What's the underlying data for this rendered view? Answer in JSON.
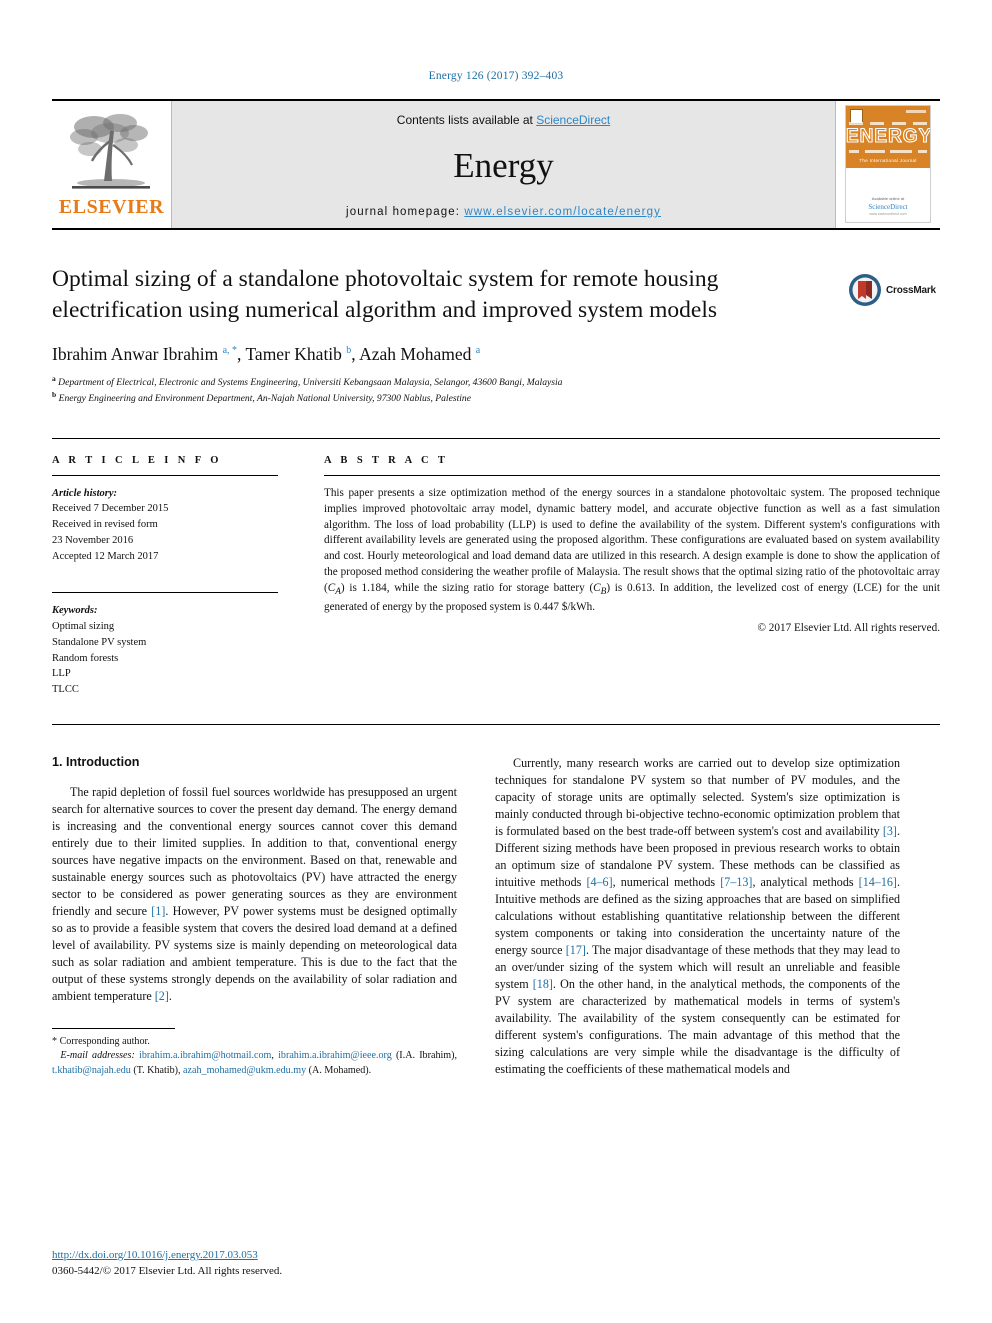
{
  "running_head": "Energy 126 (2017) 392–403",
  "banner": {
    "publisher_logo_label": "ELSEVIER",
    "contents_prefix": "Contents lists available at ",
    "contents_link": "ScienceDirect",
    "journal_name": "Energy",
    "homepage_prefix": "journal homepage: ",
    "homepage_url": "www.elsevier.com/locate/energy",
    "cover": {
      "title": "ENERGY",
      "tagline": "The International Journal",
      "available_at": "Available online at",
      "sciencedirect": "ScienceDirect",
      "sd_sub": "www.sciencedirect.com"
    }
  },
  "article": {
    "title": "Optimal sizing of a standalone photovoltaic system for remote housing electrification using numerical algorithm and improved system models",
    "crossmark_label": "CrossMark",
    "authors_html": "Ibrahim Anwar Ibrahim <sup>a, *</sup>, Tamer Khatib <sup>b</sup>, Azah Mohamed <sup>a</sup>",
    "affiliations": [
      "Department of Electrical, Electronic and Systems Engineering, Universiti Kebangsaan Malaysia, Selangor, 43600 Bangi, Malaysia",
      "Energy Engineering and Environment Department, An-Najah National University, 97300 Nablus, Palestine"
    ],
    "affiliation_marks": [
      "a",
      "b"
    ]
  },
  "article_info": {
    "heading": "A R T I C L E   I N F O",
    "history_label": "Article history:",
    "history": [
      "Received 7 December 2015",
      "Received in revised form",
      "23 November 2016",
      "Accepted 12 March 2017"
    ],
    "keywords_label": "Keywords:",
    "keywords": [
      "Optimal sizing",
      "Standalone PV system",
      "Random forests",
      "LLP",
      "TLCC"
    ]
  },
  "abstract": {
    "heading": "A B S T R A C T",
    "text_html": "This paper presents a size optimization method of the energy sources in a standalone photovoltaic system. The proposed technique implies improved photovoltaic array model, dynamic battery model, and accurate objective function as well as a fast simulation algorithm. The loss of load probability (LLP) is used to define the availability of the system. Different system's configurations with different availability levels are generated using the proposed algorithm. These configurations are evaluated based on system availability and cost. Hourly meteorological and load demand data are utilized in this research. A design example is done to show the application of the proposed method considering the weather profile of Malaysia. The result shows that the optimal sizing ratio of the photovoltaic array (<i>C<sub>A</sub></i>) is 1.184, while the sizing ratio for storage battery (<i>C<sub>B</sub></i>) is 0.613. In addition, the levelized cost of energy (LCE) for the unit generated of energy by the proposed system is 0.447 $/kWh.",
    "copyright": "© 2017 Elsevier Ltd. All rights reserved."
  },
  "body": {
    "section_number_title": "1. Introduction",
    "left_paragraphs_html": [
      "The rapid depletion of fossil fuel sources worldwide has presupposed an urgent search for alternative sources to cover the present day demand. The energy demand is increasing and the conventional energy sources cannot cover this demand entirely due to their limited supplies. In addition to that, conventional energy sources have negative impacts on the environment. Based on that, renewable and sustainable energy sources such as photovoltaics (PV) have attracted the energy sector to be considered as power generating sources as they are environment friendly and secure <span class=\"ref\">[1]</span>. However, PV power systems must be designed optimally so as to provide a feasible system that covers the desired load demand at a defined level of availability. PV systems size is mainly depending on meteorological data such as solar radiation and ambient temperature. This is due to the fact that the output of these systems strongly depends on the availability of solar radiation and ambient temperature <span class=\"ref\">[2]</span>."
    ],
    "right_paragraphs_html": [
      "Currently, many research works are carried out to develop size optimization techniques for standalone PV system so that number of PV modules, and the capacity of storage units are optimally selected. System's size optimization is mainly conducted through bi-objective techno-economic optimization problem that is formulated based on the best trade-off between system's cost and availability <span class=\"ref\">[3]</span>. Different sizing methods have been proposed in previous research works to obtain an optimum size of standalone PV system. These methods can be classified as intuitive methods <span class=\"ref\">[4–6]</span>, numerical methods <span class=\"ref\">[7–13]</span>, analytical methods <span class=\"ref\">[14–16]</span>. Intuitive methods are defined as the sizing approaches that are based on simplified calculations without establishing quantitative relationship between the different system components or taking into consideration the uncertainty nature of the energy source <span class=\"ref\">[17]</span>. The major disadvantage of these methods that they may lead to an over/under sizing of the system which will result an unreliable and feasible system <span class=\"ref\">[18]</span>. On the other hand, in the analytical methods, the components of the PV system are characterized by mathematical models in terms of system's availability. The availability of the system consequently can be estimated for different system's configurations. The main advantage of this method that the sizing calculations are very simple while the disadvantage is the difficulty of estimating the coefficients of these mathematical models and"
    ]
  },
  "footnote": {
    "corresponding_author": "* Corresponding author.",
    "email_label": "E-mail addresses:",
    "emails_html": "<span class=\"mail\">ibrahim.a.ibrahim@hotmail.com</span>, <span class=\"mail\">ibrahim.a.ibrahim@ieee.org</span> (I.A. Ibrahim), <span class=\"mail\">t.khatib@najah.edu</span> (T. Khatib), <span class=\"mail\">azah_mohamed@ukm.edu.my</span> (A. Mohamed)."
  },
  "footer": {
    "doi": "http://dx.doi.org/10.1016/j.energy.2017.03.053",
    "issn_line": "0360-5442/© 2017 Elsevier Ltd. All rights reserved."
  }
}
